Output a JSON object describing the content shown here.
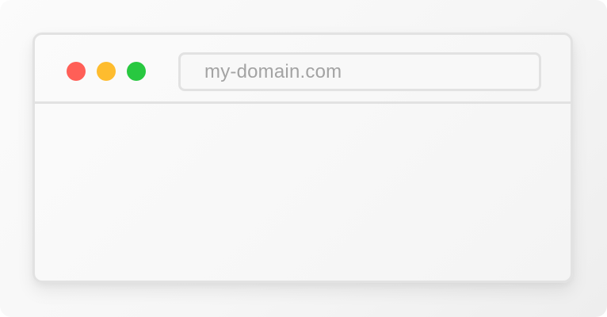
{
  "window": {
    "traffic_lights": [
      {
        "name": "close",
        "color": "#ff5f57"
      },
      {
        "name": "minimize",
        "color": "#febc2e"
      },
      {
        "name": "zoom",
        "color": "#28c840"
      }
    ],
    "address_bar": {
      "url": "my-domain.com"
    },
    "content": {}
  }
}
